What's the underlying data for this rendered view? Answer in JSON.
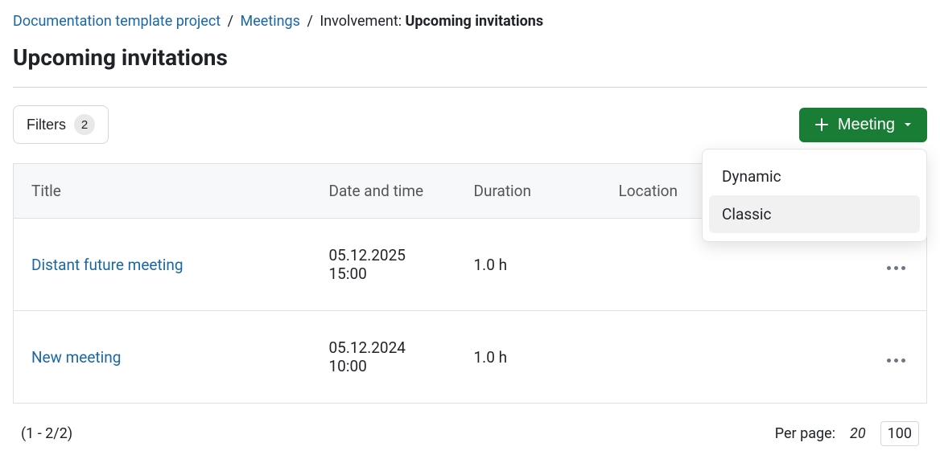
{
  "breadcrumb": {
    "items": [
      {
        "label": "Documentation template project"
      },
      {
        "label": "Meetings"
      }
    ],
    "current_label": "Involvement: ",
    "current_value": "Upcoming invitations"
  },
  "page_title": "Upcoming invitations",
  "toolbar": {
    "filters_label": "Filters",
    "filters_count": "2",
    "meeting_button_label": "Meeting",
    "dropdown": {
      "items": [
        {
          "label": "Dynamic",
          "hovered": false
        },
        {
          "label": "Classic",
          "hovered": true
        }
      ]
    }
  },
  "table": {
    "headers": {
      "title": "Title",
      "datetime": "Date and time",
      "duration": "Duration",
      "location": "Location"
    },
    "rows": [
      {
        "title": "Distant future meeting",
        "datetime": "05.12.2025 15:00",
        "duration": "1.0 h",
        "location": ""
      },
      {
        "title": "New meeting",
        "datetime": "05.12.2024 10:00",
        "duration": "1.0 h",
        "location": ""
      }
    ]
  },
  "footer": {
    "range": "(1 - 2/2)",
    "per_page_label": "Per page:",
    "per_page_options": [
      "20",
      "100"
    ]
  }
}
